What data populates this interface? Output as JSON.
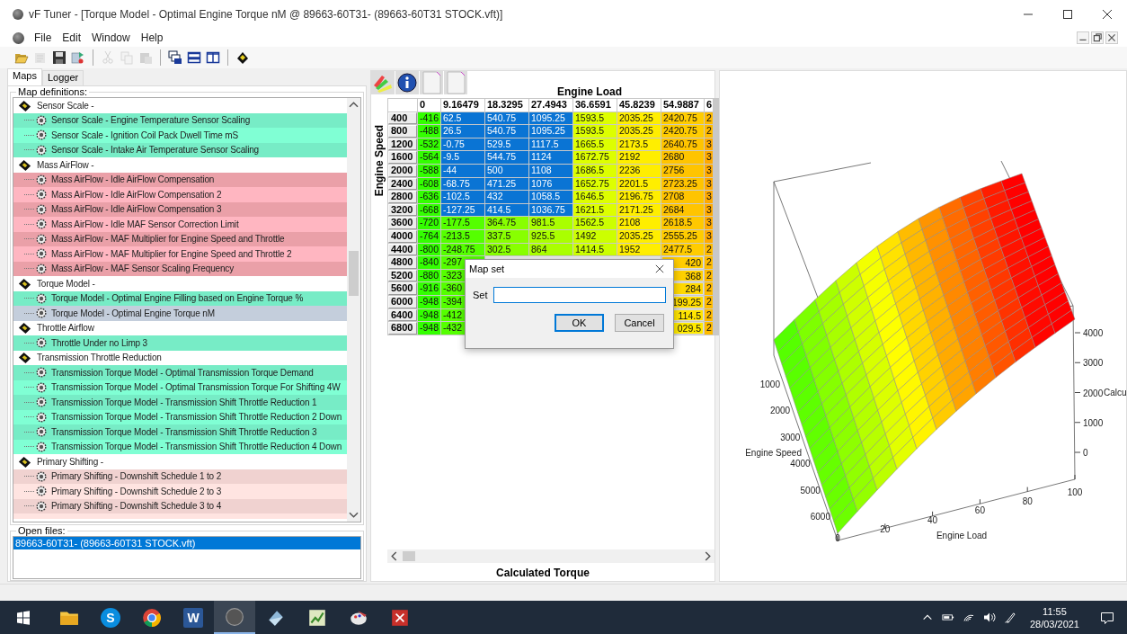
{
  "window": {
    "title": "vF Tuner  - [Torque Model - Optimal Engine Torque nM @ 89663-60T31- (89663-60T31 STOCK.vft)]"
  },
  "menu": [
    "File",
    "Edit",
    "Window",
    "Help"
  ],
  "toolbar": [
    {
      "kind": "open",
      "disabled": false
    },
    {
      "kind": "properties",
      "disabled": true
    },
    {
      "kind": "save",
      "disabled": false
    },
    {
      "kind": "import",
      "disabled": false
    },
    {
      "kind": "separator"
    },
    {
      "kind": "cut",
      "disabled": true
    },
    {
      "kind": "copy",
      "disabled": true
    },
    {
      "kind": "paste",
      "disabled": true
    },
    {
      "kind": "separator"
    },
    {
      "kind": "cascade",
      "disabled": false
    },
    {
      "kind": "tile-horizontal",
      "disabled": false
    },
    {
      "kind": "tile-vertical",
      "disabled": false
    },
    {
      "kind": "separator"
    },
    {
      "kind": "chip",
      "disabled": false
    }
  ],
  "tabs": [
    {
      "label": "Maps",
      "selected": true
    },
    {
      "label": "Logger",
      "selected": false
    }
  ],
  "map_definitions": {
    "title": "Map definitions:",
    "groups": [
      {
        "label": "Sensor Scale -",
        "children": [
          {
            "label": "Sensor Scale - Engine Temperature Sensor Scaling",
            "selected": false,
            "color": "#77ecc6"
          },
          {
            "label": "Sensor Scale - Ignition Coil Pack Dwell Time mS",
            "selected": false,
            "color": "#80ffd4"
          },
          {
            "label": "Sensor Scale - Intake Air Temperature Sensor Scaling",
            "selected": false,
            "color": "#77ecc6"
          }
        ]
      },
      {
        "label": "Mass AirFlow -",
        "children": [
          {
            "label": "Mass AirFlow - Idle AirFlow Compensation",
            "selected": false,
            "color": "#eaa0a8"
          },
          {
            "label": "Mass AirFlow - Idle AirFlow Compensation 2",
            "selected": false,
            "color": "#ffb6c1"
          },
          {
            "label": "Mass AirFlow - Idle AirFlow Compensation 3",
            "selected": false,
            "color": "#eaa0a8"
          },
          {
            "label": "Mass AirFlow - Idle MAF Sensor Correction Limit",
            "selected": false,
            "color": "#ffb6c1"
          },
          {
            "label": "Mass AirFlow - MAF Multiplier for Engine Speed and Throttle",
            "selected": false,
            "color": "#eaa0a8"
          },
          {
            "label": "Mass AirFlow - MAF Multiplier for Engine Speed and Throttle 2",
            "selected": false,
            "color": "#ffb6c1"
          },
          {
            "label": "Mass AirFlow - MAF Sensor Scaling Frequency",
            "selected": false,
            "color": "#eaa0a8"
          }
        ]
      },
      {
        "label": "Torque Model -",
        "children": [
          {
            "label": "Torque Model - Optimal Engine Filling based on Engine Torque %",
            "selected": false,
            "color": "#77ecc6"
          },
          {
            "label": "Torque Model - Optimal Engine Torque nM",
            "selected": true
          }
        ]
      },
      {
        "label": "Throttle Airflow",
        "children": [
          {
            "label": "Throttle Under no Limp 3",
            "selected": false,
            "color": "#77ecc6"
          }
        ]
      },
      {
        "label": "Transmission Throttle Reduction",
        "children": [
          {
            "label": "Transmission Torque Model - Optimal Transmission Torque Demand",
            "selected": false,
            "color": "#77ecc6"
          },
          {
            "label": "Transmission Torque Model - Optimal Transmission Torque For Shifting 4W",
            "selected": false,
            "color": "#80ffd4"
          },
          {
            "label": "Transmission Torque Model - Transmission Shift Throttle Reduction 1",
            "selected": false,
            "color": "#77ecc6"
          },
          {
            "label": "Transmission Torque Model - Transmission Shift Throttle Reduction 2 Down",
            "selected": false,
            "color": "#80ffd4"
          },
          {
            "label": "Transmission Torque Model - Transmission Shift Throttle Reduction 3",
            "selected": false,
            "color": "#77ecc6"
          },
          {
            "label": "Transmission Torque Model - Transmission Shift Throttle Reduction 4 Down",
            "selected": false,
            "color": "#80ffd4"
          }
        ]
      },
      {
        "label": "Primary Shifting -",
        "children": [
          {
            "label": "Primary Shifting - Downshift Schedule 1 to 2",
            "selected": false,
            "color": "#f0d2d0"
          },
          {
            "label": "Primary Shifting - Downshift Schedule 2 to 3",
            "selected": false,
            "color": "#ffe4e1"
          },
          {
            "label": "Primary Shifting - Downshift Schedule 3 to 4",
            "selected": false,
            "color": "#f0d2d0"
          }
        ]
      }
    ]
  },
  "open_files": {
    "title": "Open files:",
    "items": [
      {
        "label": "89663-60T31- (89663-60T31 STOCK.vft)",
        "selected": true
      }
    ]
  },
  "table_tools": [
    {
      "kind": "palette"
    },
    {
      "kind": "info"
    },
    {
      "kind": "page"
    },
    {
      "kind": "page"
    }
  ],
  "table": {
    "x_title": "Engine Load",
    "y_title": "Engine Speed",
    "footer": "Calculated Torque",
    "columns": [
      "0",
      "9.16479",
      "18.3295",
      "27.4943",
      "36.6591",
      "45.8239",
      "54.9887",
      "6"
    ],
    "rows": [
      {
        "speed": "400",
        "covered": false,
        "cells": [
          {
            "text": "-416",
            "selected": false,
            "color": "#33ff00"
          },
          {
            "text": "62.5",
            "selected": true
          },
          {
            "text": "540.75",
            "selected": true
          },
          {
            "text": "1095.25",
            "selected": true
          },
          {
            "text": "1593.5",
            "selected": false,
            "color": "#ddff00"
          },
          {
            "text": "2035.25",
            "selected": false,
            "color": "#ffee00"
          },
          {
            "text": "2420.75",
            "selected": false,
            "color": "#ffcc00"
          },
          {
            "text": "2",
            "selected": false,
            "color": "#ffbb00"
          }
        ]
      },
      {
        "speed": "800",
        "covered": false,
        "cells": [
          {
            "text": "-488",
            "selected": false,
            "color": "#33ff00"
          },
          {
            "text": "26.5",
            "selected": true
          },
          {
            "text": "540.75",
            "selected": true
          },
          {
            "text": "1095.25",
            "selected": true
          },
          {
            "text": "1593.5",
            "selected": false,
            "color": "#ddff00"
          },
          {
            "text": "2035.25",
            "selected": false,
            "color": "#ffee00"
          },
          {
            "text": "2420.75",
            "selected": false,
            "color": "#ffcc00"
          },
          {
            "text": "2",
            "selected": false,
            "color": "#ffbb00"
          }
        ]
      },
      {
        "speed": "1200",
        "covered": false,
        "cells": [
          {
            "text": "-532",
            "selected": false,
            "color": "#33ff00"
          },
          {
            "text": "-0.75",
            "selected": true
          },
          {
            "text": "529.5",
            "selected": true
          },
          {
            "text": "1117.5",
            "selected": true
          },
          {
            "text": "1665.5",
            "selected": false,
            "color": "#ddff00"
          },
          {
            "text": "2173.5",
            "selected": false,
            "color": "#ffee00"
          },
          {
            "text": "2640.75",
            "selected": false,
            "color": "#ffc400"
          },
          {
            "text": "3",
            "selected": false,
            "color": "#ffaa00"
          }
        ]
      },
      {
        "speed": "1600",
        "covered": false,
        "cells": [
          {
            "text": "-564",
            "selected": false,
            "color": "#33ff00"
          },
          {
            "text": "-9.5",
            "selected": true
          },
          {
            "text": "544.75",
            "selected": true
          },
          {
            "text": "1124",
            "selected": true
          },
          {
            "text": "1672.75",
            "selected": false,
            "color": "#ddff00"
          },
          {
            "text": "2192",
            "selected": false,
            "color": "#ffee00"
          },
          {
            "text": "2680",
            "selected": false,
            "color": "#ffc400"
          },
          {
            "text": "3",
            "selected": false,
            "color": "#ffaa00"
          }
        ]
      },
      {
        "speed": "2000",
        "covered": false,
        "cells": [
          {
            "text": "-588",
            "selected": false,
            "color": "#33ff00"
          },
          {
            "text": "-44",
            "selected": true
          },
          {
            "text": "500",
            "selected": true
          },
          {
            "text": "1108",
            "selected": true
          },
          {
            "text": "1686.5",
            "selected": false,
            "color": "#ddff00"
          },
          {
            "text": "2236",
            "selected": false,
            "color": "#ffee00"
          },
          {
            "text": "2756",
            "selected": false,
            "color": "#ffc400"
          },
          {
            "text": "3",
            "selected": false,
            "color": "#ffaa00"
          }
        ]
      },
      {
        "speed": "2400",
        "covered": false,
        "cells": [
          {
            "text": "-608",
            "selected": false,
            "color": "#33ff00"
          },
          {
            "text": "-68.75",
            "selected": true
          },
          {
            "text": "471.25",
            "selected": true
          },
          {
            "text": "1076",
            "selected": true
          },
          {
            "text": "1652.75",
            "selected": false,
            "color": "#ddff00"
          },
          {
            "text": "2201.5",
            "selected": false,
            "color": "#ffee00"
          },
          {
            "text": "2723.25",
            "selected": false,
            "color": "#ffc400"
          },
          {
            "text": "3",
            "selected": false,
            "color": "#ffaa00"
          }
        ]
      },
      {
        "speed": "2800",
        "covered": false,
        "cells": [
          {
            "text": "-636",
            "selected": false,
            "color": "#33ff00"
          },
          {
            "text": "-102.5",
            "selected": true
          },
          {
            "text": "432",
            "selected": true
          },
          {
            "text": "1058.5",
            "selected": true
          },
          {
            "text": "1646.5",
            "selected": false,
            "color": "#ddff00"
          },
          {
            "text": "2196.75",
            "selected": false,
            "color": "#ffee00"
          },
          {
            "text": "2708",
            "selected": false,
            "color": "#ffc400"
          },
          {
            "text": "3",
            "selected": false,
            "color": "#ffaa00"
          }
        ]
      },
      {
        "speed": "3200",
        "covered": false,
        "cells": [
          {
            "text": "-668",
            "selected": false,
            "color": "#33ff00"
          },
          {
            "text": "-127.25",
            "selected": true
          },
          {
            "text": "414.5",
            "selected": true
          },
          {
            "text": "1036.75",
            "selected": true
          },
          {
            "text": "1621.5",
            "selected": false,
            "color": "#ddff00"
          },
          {
            "text": "2171.25",
            "selected": false,
            "color": "#ffee00"
          },
          {
            "text": "2684",
            "selected": false,
            "color": "#ffc400"
          },
          {
            "text": "3",
            "selected": false,
            "color": "#ffaa00"
          }
        ]
      },
      {
        "speed": "3600",
        "covered": false,
        "cells": [
          {
            "text": "-720",
            "selected": false,
            "color": "#33ff00"
          },
          {
            "text": "-177.5",
            "selected": false,
            "color": "#55ff00"
          },
          {
            "text": "364.75",
            "selected": false,
            "color": "#88ff00"
          },
          {
            "text": "981.5",
            "selected": false,
            "color": "#aaff00"
          },
          {
            "text": "1562.5",
            "selected": false,
            "color": "#ccff00"
          },
          {
            "text": "2108",
            "selected": false,
            "color": "#ffee00"
          },
          {
            "text": "2618.5",
            "selected": false,
            "color": "#ffc800"
          },
          {
            "text": "3",
            "selected": false,
            "color": "#ffaa00"
          }
        ]
      },
      {
        "speed": "4000",
        "covered": false,
        "cells": [
          {
            "text": "-764",
            "selected": false,
            "color": "#33ff00"
          },
          {
            "text": "-213.5",
            "selected": false,
            "color": "#55ff00"
          },
          {
            "text": "337.5",
            "selected": false,
            "color": "#88ff00"
          },
          {
            "text": "925.5",
            "selected": false,
            "color": "#aaff00"
          },
          {
            "text": "1492",
            "selected": false,
            "color": "#ccff00"
          },
          {
            "text": "2035.25",
            "selected": false,
            "color": "#ffee00"
          },
          {
            "text": "2555.25",
            "selected": false,
            "color": "#ffcc00"
          },
          {
            "text": "3",
            "selected": false,
            "color": "#ffaa00"
          }
        ]
      },
      {
        "speed": "4400",
        "covered": false,
        "cells": [
          {
            "text": "-800",
            "selected": false,
            "color": "#33ff00"
          },
          {
            "text": "-248.75",
            "selected": false,
            "color": "#55ff00"
          },
          {
            "text": "302.5",
            "selected": false,
            "color": "#88ff00"
          },
          {
            "text": "864",
            "selected": false,
            "color": "#aaff00"
          },
          {
            "text": "1414.5",
            "selected": false,
            "color": "#ccff00"
          },
          {
            "text": "1952",
            "selected": false,
            "color": "#ffee00"
          },
          {
            "text": "2477.5",
            "selected": false,
            "color": "#ffcc00"
          },
          {
            "text": "2",
            "selected": false,
            "color": "#ffbb00"
          }
        ]
      },
      {
        "speed": "4800",
        "covered": true,
        "cells": [
          {
            "text": "-840",
            "selected": false,
            "color": "#33ff00"
          },
          {
            "text": "-297",
            "selected": false,
            "color": "#55ff00"
          },
          {
            "text": "420",
            "selected": false,
            "color": "#ffcc00"
          },
          {
            "text": "2",
            "selected": false,
            "color": "#ffbb00"
          }
        ]
      },
      {
        "speed": "5200",
        "covered": true,
        "cells": [
          {
            "text": "-880",
            "selected": false,
            "color": "#33ff00"
          },
          {
            "text": "-323",
            "selected": false,
            "color": "#55ff00"
          },
          {
            "text": "368",
            "selected": false,
            "color": "#ffd000"
          },
          {
            "text": "2",
            "selected": false,
            "color": "#ffbb00"
          }
        ]
      },
      {
        "speed": "5600",
        "covered": true,
        "cells": [
          {
            "text": "-916",
            "selected": false,
            "color": "#33ff00"
          },
          {
            "text": "-360",
            "selected": false,
            "color": "#55ff00"
          },
          {
            "text": "284",
            "selected": false,
            "color": "#ffd800"
          },
          {
            "text": "2",
            "selected": false,
            "color": "#ffbb00"
          }
        ]
      },
      {
        "speed": "6000",
        "covered": true,
        "cells": [
          {
            "text": "-948",
            "selected": false,
            "color": "#33ff00"
          },
          {
            "text": "-394",
            "selected": false,
            "color": "#55ff00"
          },
          {
            "text": "199.25",
            "selected": false,
            "color": "#ffdd00"
          },
          {
            "text": "2",
            "selected": false,
            "color": "#ffbb00"
          }
        ]
      },
      {
        "speed": "6400",
        "covered": true,
        "cells": [
          {
            "text": "-948",
            "selected": false,
            "color": "#33ff00"
          },
          {
            "text": "-412",
            "selected": false,
            "color": "#55ff00"
          },
          {
            "text": "114.5",
            "selected": false,
            "color": "#ffe400"
          },
          {
            "text": "2",
            "selected": false,
            "color": "#ffbb00"
          }
        ]
      },
      {
        "speed": "6800",
        "covered": true,
        "cells": [
          {
            "text": "-948",
            "selected": false,
            "color": "#33ff00"
          },
          {
            "text": "-432",
            "selected": false,
            "color": "#55ff00"
          },
          {
            "text": "029.5",
            "selected": false,
            "color": "#ffea00"
          },
          {
            "text": "2",
            "selected": false,
            "color": "#ffbb00"
          }
        ]
      }
    ]
  },
  "dialog": {
    "title": "Map set",
    "field_label": "Set",
    "buttons": [
      {
        "label": "OK",
        "default": true
      },
      {
        "label": "Cancel",
        "default": false
      }
    ]
  },
  "surface_plot": {
    "value_ticks": [
      "4000",
      "3000",
      "2000",
      "1000",
      "0"
    ],
    "value_title": "Calcu",
    "speed_ticks": [
      "1000",
      "2000",
      "3000",
      "4000",
      "5000",
      "6000"
    ],
    "speed_title": "Engine Speed",
    "load_ticks": [
      "0",
      "20",
      "40",
      "60",
      "80",
      "100"
    ],
    "load_title": "Engine Load"
  },
  "taskbar": {
    "apps": [
      {
        "kind": "explorer",
        "active": false
      },
      {
        "kind": "skype",
        "label": "S",
        "active": false
      },
      {
        "kind": "chrome",
        "active": false
      },
      {
        "kind": "word",
        "label": "W",
        "active": false
      },
      {
        "kind": "vftuner",
        "active": true
      },
      {
        "kind": "gem",
        "active": false
      },
      {
        "kind": "chart",
        "active": false
      },
      {
        "kind": "paint",
        "active": false
      },
      {
        "kind": "cross",
        "active": false
      }
    ],
    "time": "11:55",
    "date": "28/03/2021"
  }
}
